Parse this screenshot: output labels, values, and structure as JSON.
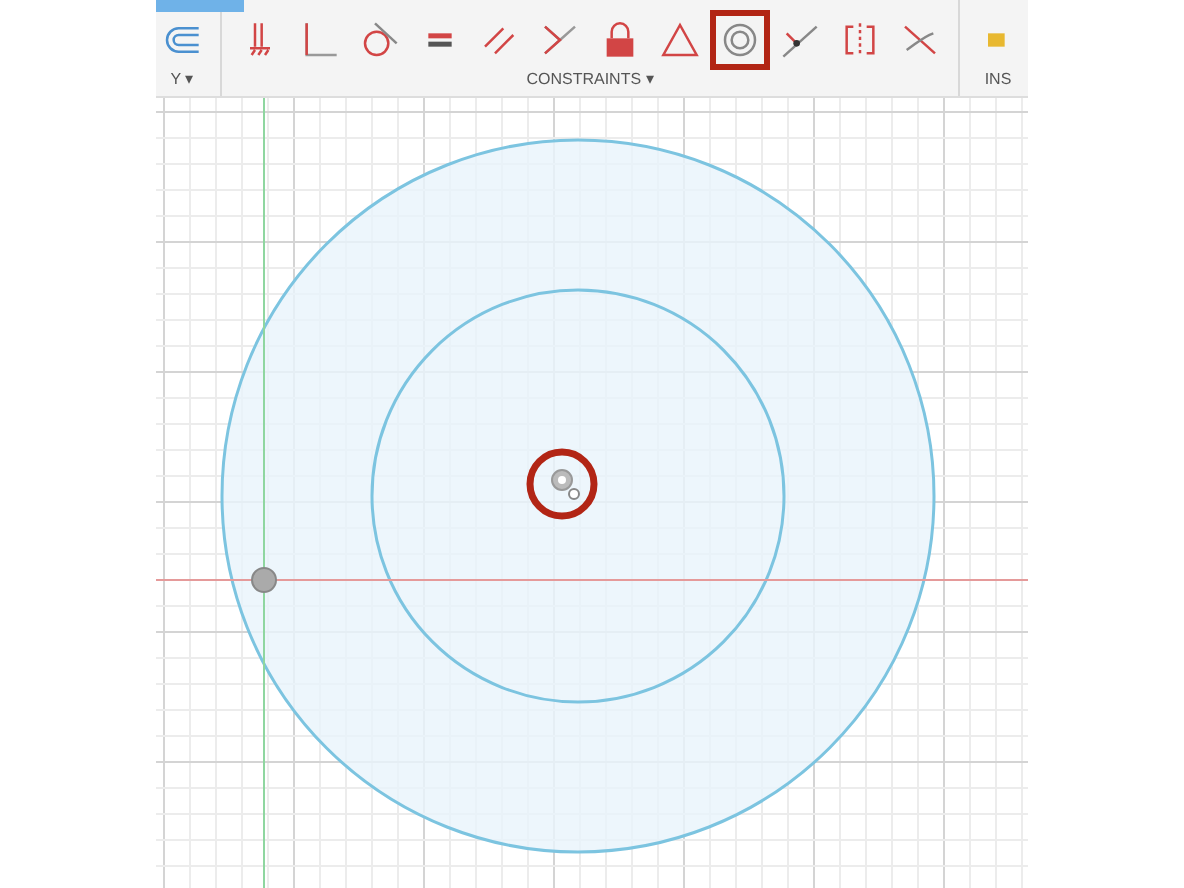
{
  "toolbar": {
    "groups": [
      {
        "label": "Y ▾",
        "tools": [
          {
            "kind": "fillet",
            "selected": false
          }
        ]
      },
      {
        "label": "CONSTRAINTS ▾",
        "tools": [
          {
            "kind": "fix",
            "selected": false
          },
          {
            "kind": "perpendicular",
            "selected": false
          },
          {
            "kind": "tangent",
            "selected": false
          },
          {
            "kind": "equal",
            "selected": false
          },
          {
            "kind": "parallel",
            "selected": false
          },
          {
            "kind": "collinear",
            "selected": false
          },
          {
            "kind": "lock",
            "selected": false
          },
          {
            "kind": "triangle",
            "selected": false
          },
          {
            "kind": "concentric",
            "selected": true
          },
          {
            "kind": "midpoint",
            "selected": false
          },
          {
            "kind": "symmetry",
            "selected": false
          },
          {
            "kind": "curvature",
            "selected": false
          }
        ]
      },
      {
        "label": "INS",
        "tools": [
          {
            "kind": "insert",
            "selected": false
          }
        ]
      }
    ]
  },
  "canvas": {
    "highlight_center": true
  }
}
